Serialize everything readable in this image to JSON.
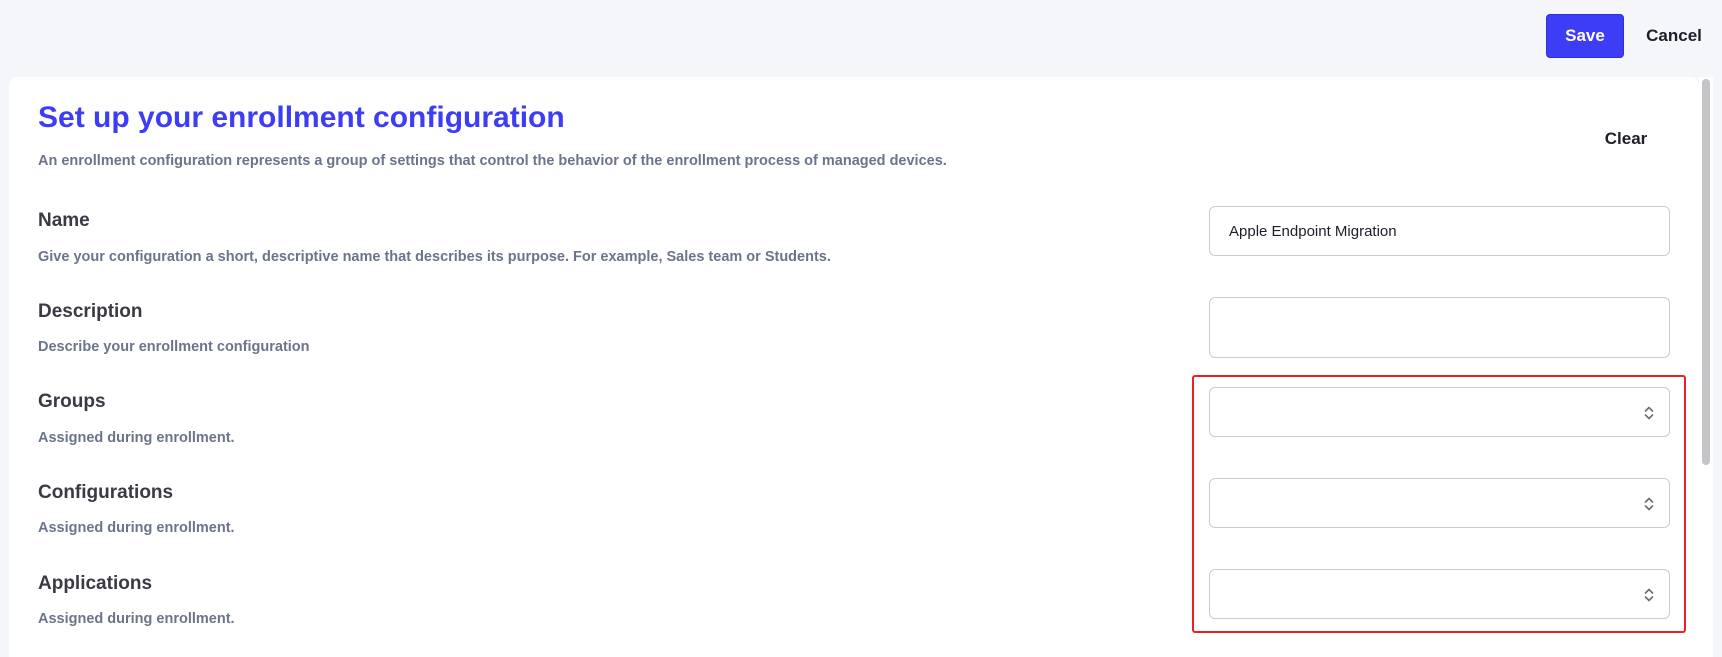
{
  "header": {
    "save_label": "Save",
    "cancel_label": "Cancel"
  },
  "form": {
    "title": "Set up your enrollment configuration",
    "subtitle": "An enrollment configuration represents a group of settings that control the behavior of the enrollment process of managed devices.",
    "clear_label": "Clear",
    "fields": {
      "name": {
        "label": "Name",
        "help": "Give your configuration a short, descriptive name that describes its purpose. For example, Sales team or Students.",
        "value": "Apple Endpoint Migration"
      },
      "description": {
        "label": "Description",
        "help": "Describe your enrollment configuration",
        "value": ""
      },
      "groups": {
        "label": "Groups",
        "help": "Assigned during enrollment.",
        "value": ""
      },
      "configurations": {
        "label": "Configurations",
        "help": "Assigned during enrollment.",
        "value": ""
      },
      "applications": {
        "label": "Applications",
        "help": "Assigned during enrollment.",
        "value": ""
      }
    }
  },
  "icons": {
    "select_chevron": "chevron-up-down-icon"
  },
  "colors": {
    "accent": "#3d3df5",
    "highlight": "#e8212b",
    "muted_text": "#6b7489"
  }
}
